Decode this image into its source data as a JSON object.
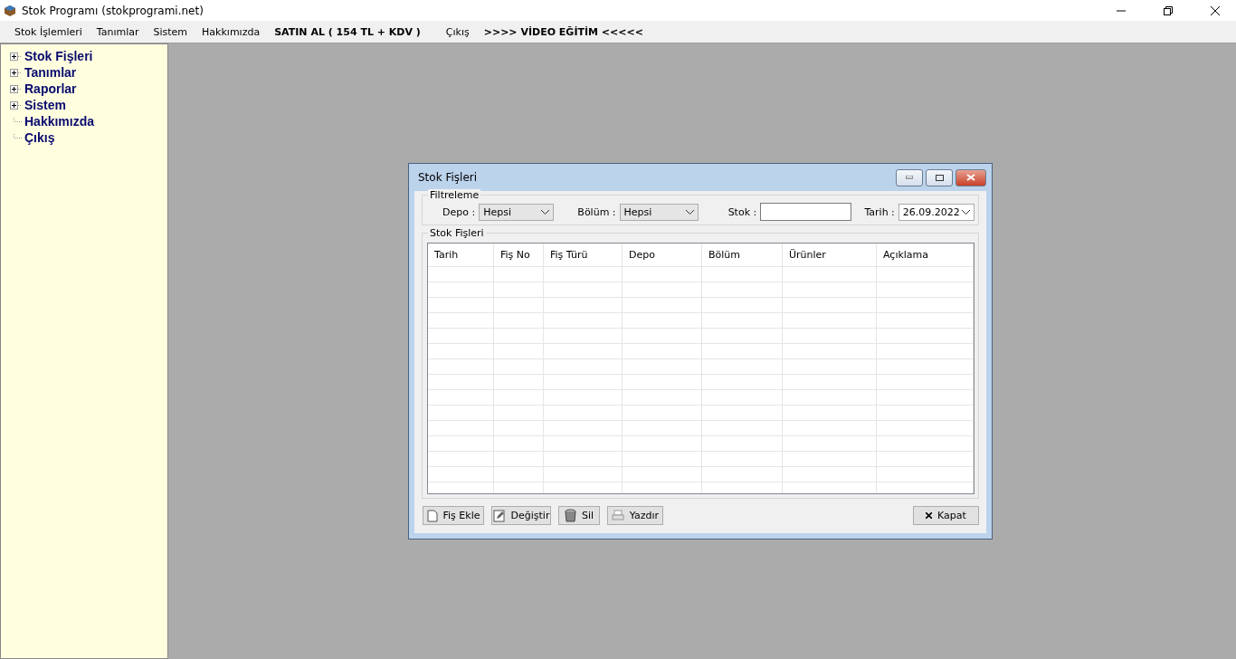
{
  "window": {
    "title": "Stok Programı (stokprogrami.net)"
  },
  "menu": [
    {
      "label": "Stok İşlemleri",
      "bold": false
    },
    {
      "label": "Tanımlar",
      "bold": false
    },
    {
      "label": "Sistem",
      "bold": false
    },
    {
      "label": "Hakkımızda",
      "bold": false
    },
    {
      "label": "SATIN AL ( 154 TL + KDV )",
      "bold": true
    },
    {
      "label": "Çıkış",
      "bold": false
    },
    {
      "label": ">>>> VİDEO EĞİTİM <<<<<",
      "bold": true
    }
  ],
  "sidebar": {
    "items": [
      {
        "label": "Stok Fişleri",
        "kind": "group"
      },
      {
        "label": "Tanımlar",
        "kind": "group"
      },
      {
        "label": "Raporlar",
        "kind": "group"
      },
      {
        "label": "Sistem",
        "kind": "group"
      },
      {
        "label": "Hakkımızda",
        "kind": "leaf"
      },
      {
        "label": "Çıkış",
        "kind": "leaf"
      }
    ]
  },
  "dialog": {
    "title": "Stok Fişleri",
    "filter": {
      "legend": "Filtreleme",
      "depo_label": "Depo :",
      "depo_value": "Hepsi",
      "bolum_label": "Bölüm :",
      "bolum_value": "Hepsi",
      "stok_label": "Stok :",
      "tarih_label": "Tarih :",
      "tarih_value": "26.09.2022"
    },
    "table": {
      "legend": "Stok Fişleri",
      "columns": [
        "Tarih",
        "Fiş No",
        "Fiş Türü",
        "Depo",
        "Bölüm",
        "Ürünler",
        "Açıklama"
      ]
    },
    "buttons": [
      {
        "label": "Fiş Ekle",
        "kind": "new"
      },
      {
        "label": "Değiştir",
        "kind": "edit"
      },
      {
        "label": "Sil",
        "kind": "delete"
      },
      {
        "label": "Yazdır",
        "kind": "print"
      }
    ],
    "close_button": "Kapat"
  }
}
